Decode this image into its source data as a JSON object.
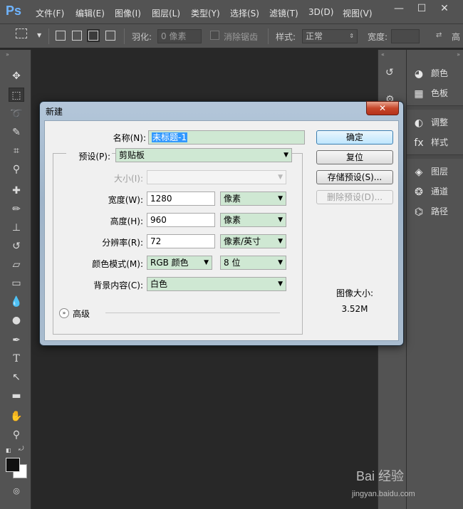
{
  "app": {
    "logo": "Ps"
  },
  "menubar": {
    "items": [
      "文件(F)",
      "编辑(E)",
      "图像(I)",
      "图层(L)",
      "类型(Y)",
      "选择(S)",
      "滤镜(T)",
      "3D(D)",
      "视图(V)"
    ],
    "window_controls": [
      "—",
      "☐",
      "✕"
    ]
  },
  "optbar": {
    "feather_label": "羽化:",
    "feather_value": "0 像素",
    "antialias_label": "消除锯齿",
    "style_label": "样式:",
    "style_value": "正常",
    "width_label": "宽度:",
    "height_label_partial": "高"
  },
  "panels": {
    "items": [
      {
        "icon": "palette-icon",
        "label": "颜色"
      },
      {
        "icon": "swatches-icon",
        "label": "色板"
      },
      {
        "icon": "adjustments-icon",
        "label": "调整"
      },
      {
        "icon": "styles-icon",
        "label": "样式"
      },
      {
        "icon": "layers-icon",
        "label": "图层"
      },
      {
        "icon": "channels-icon",
        "label": "通道"
      },
      {
        "icon": "paths-icon",
        "label": "路径"
      }
    ]
  },
  "dialog": {
    "title": "新建",
    "close": "✕",
    "name_label": "名称(N):",
    "name_value": "未标题-1",
    "preset_label": "预设(P):",
    "preset_value": "剪贴板",
    "size_label": "大小(I):",
    "width_label": "宽度(W):",
    "width_value": "1280",
    "width_unit": "像素",
    "height_label": "高度(H):",
    "height_value": "960",
    "height_unit": "像素",
    "resolution_label": "分辨率(R):",
    "resolution_value": "72",
    "resolution_unit": "像素/英寸",
    "color_mode_label": "颜色模式(M):",
    "color_mode_value": "RGB 颜色",
    "bit_depth_value": "8 位",
    "background_label": "背景内容(C):",
    "background_value": "白色",
    "advanced_label": "高级",
    "image_size_label": "图像大小:",
    "image_size_value": "3.52M",
    "buttons": {
      "ok": "确定",
      "reset": "复位",
      "save_preset": "存储预设(S)...",
      "delete_preset": "删除预设(D)..."
    }
  },
  "watermark": {
    "text": "Bai 经验",
    "url": "jingyan.baidu.com"
  }
}
